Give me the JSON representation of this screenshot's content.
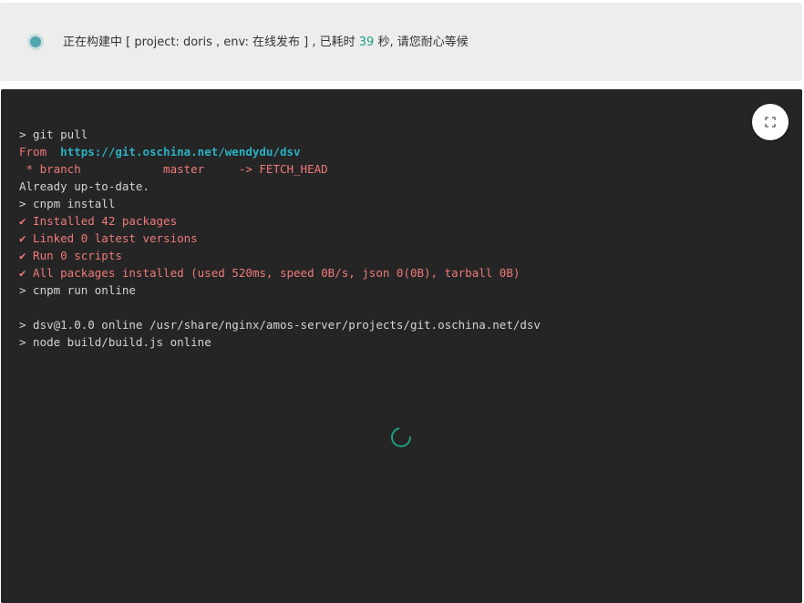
{
  "status": {
    "text_before": "正在构建中 [ project: doris , env: 在线发布 ] ,  已耗时 ",
    "elapsed": "39",
    "text_after": " 秒, 请您耐心等候",
    "dot_color": "#4fa6ad",
    "elapsed_color": "#1c9e82"
  },
  "console": {
    "fullscreen_icon": "expand-icon",
    "lines": [
      "> git pull",
      "From  ",
      " * branch            master     -> FETCH_HEAD",
      "Already up-to-date.",
      "> cnpm install",
      "✔ Installed 42 packages",
      "✔ Linked 0 latest versions",
      "✔ Run 0 scripts",
      "✔ All packages installed (used 520ms, speed 0B/s, json 0(0B), tarball 0B)",
      "> cnpm run online",
      "",
      "> dsv@1.0.0 online /usr/share/nginx/amos-server/projects/git.oschina.net/dsv",
      "> node build/build.js online"
    ],
    "repo_url": "https://git.oschina.net/wendydu/dsv",
    "loading_icon": "spinner-icon",
    "colors": {
      "background": "#252526",
      "text": "#d4d4d4",
      "highlight": "#ef7a78",
      "link": "#2bb0c2"
    }
  }
}
